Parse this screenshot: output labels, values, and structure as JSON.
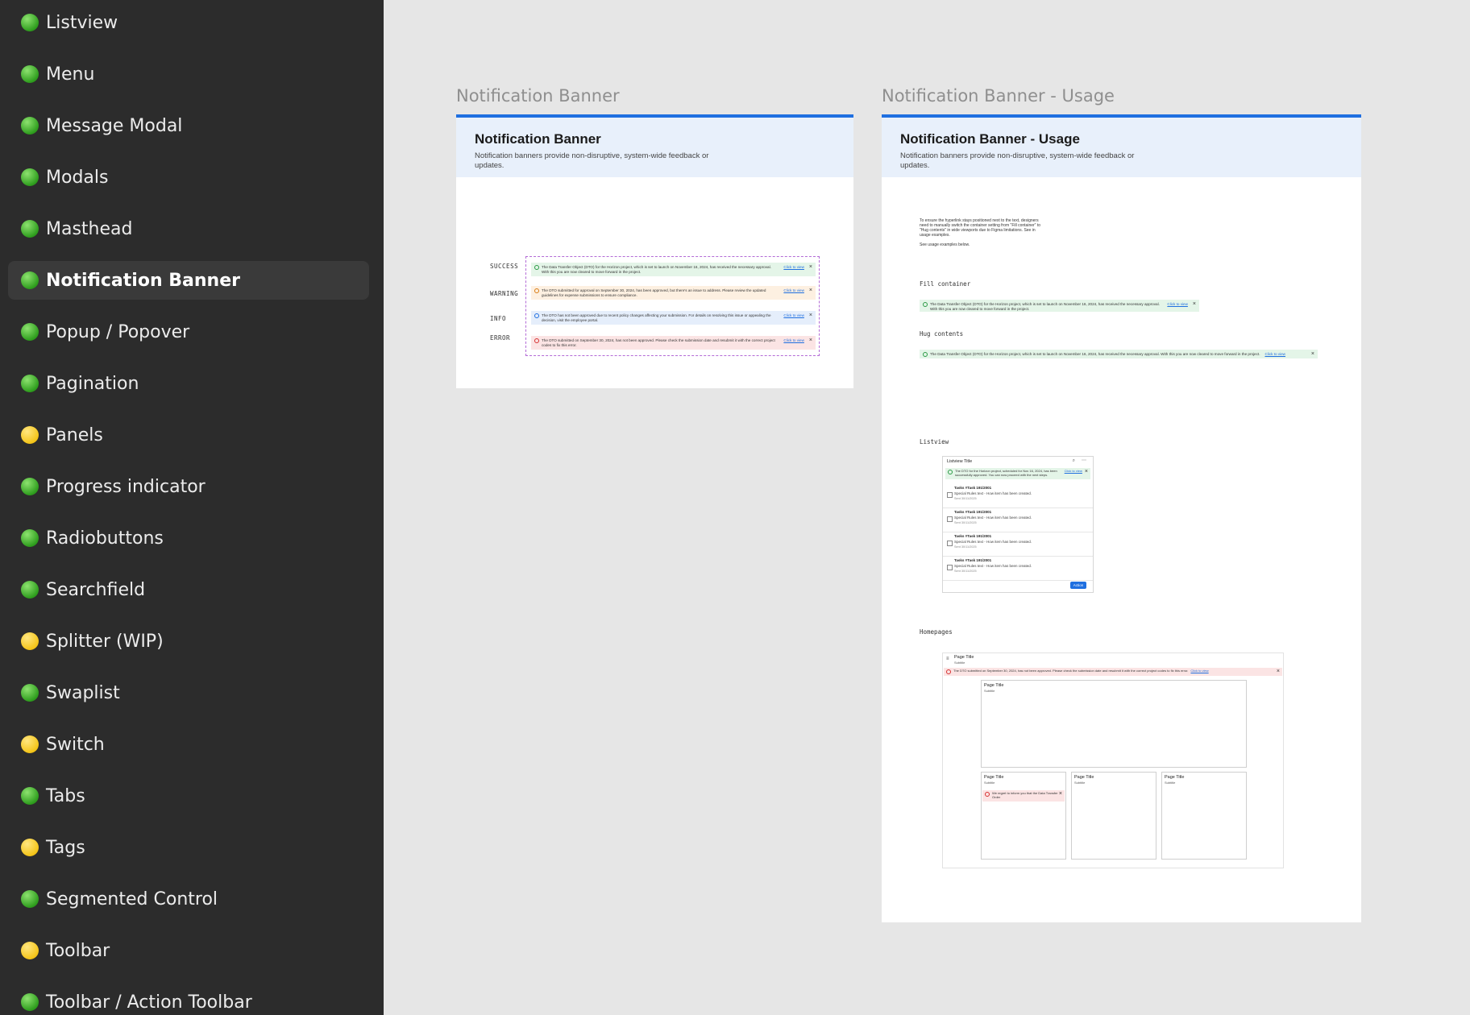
{
  "sidebar": {
    "items": [
      {
        "label": "Listview",
        "status": "green"
      },
      {
        "label": "Menu",
        "status": "green"
      },
      {
        "label": "Message Modal",
        "status": "green"
      },
      {
        "label": "Modals",
        "status": "green"
      },
      {
        "label": "Masthead",
        "status": "green"
      },
      {
        "label": "Notification Banner",
        "status": "green",
        "selected": true
      },
      {
        "label": "Popup / Popover",
        "status": "green"
      },
      {
        "label": "Pagination",
        "status": "green"
      },
      {
        "label": "Panels",
        "status": "yellow"
      },
      {
        "label": "Progress indicator",
        "status": "green"
      },
      {
        "label": "Radiobuttons",
        "status": "green"
      },
      {
        "label": "Searchfield",
        "status": "green"
      },
      {
        "label": "Splitter (WIP)",
        "status": "yellow"
      },
      {
        "label": "Swaplist",
        "status": "green"
      },
      {
        "label": "Switch",
        "status": "yellow"
      },
      {
        "label": "Tabs",
        "status": "green"
      },
      {
        "label": "Tags",
        "status": "yellow"
      },
      {
        "label": "Segmented Control",
        "status": "green"
      },
      {
        "label": "Toolbar",
        "status": "yellow"
      },
      {
        "label": "Toolbar / Action Toolbar",
        "status": "green"
      }
    ]
  },
  "colors": {
    "accent": "#1f6fe0",
    "success": "#2a9b45",
    "warning": "#d97b11",
    "error": "#d63030"
  },
  "frame1": {
    "label": "Notification Banner",
    "title": "Notification Banner",
    "description": "Notification banners provide non-disruptive, system-wide feedback or updates.",
    "link_text": "Click to view",
    "variants": [
      {
        "label": "SUCCESS",
        "type": "success",
        "text": "The Data Transfer Object (DTO) for the Horizon project, which is set to launch on November 16, 2024, has received the necessary approval. With this you are now cleared to move forward in the project."
      },
      {
        "label": "WARNING",
        "type": "warning",
        "text": "The DTO submitted for approval on September 30, 2024, has been approved, but there's an issue to address. Please review the updated guidelines for expense submissions to ensure compliance."
      },
      {
        "label": "INFO",
        "type": "info",
        "text": "The DTO has not been approved due to recent policy changes affecting your submission. For details on resolving this issue or appealing the decision, visit the employee portal."
      },
      {
        "label": "ERROR",
        "type": "error",
        "text": "The DTO submitted on September 30, 2024, has not been approved. Please check the submission date and resubmit it with the correct project codes to fix this error."
      }
    ]
  },
  "frame2": {
    "label": "Notification Banner - Usage",
    "title": "Notification Banner - Usage",
    "description": "Notification banners provide non-disruptive, system-wide feedback or updates.",
    "intro": "To ensure the hyperlink stays positioned next to the text, designers need to manually switch the container setting from \"Fill container\" to \"Hug contents\" in wide viewports due to Figma limitations. See in usage examples.",
    "intro2": "See usage examples below.",
    "fill_label": "Fill container",
    "fill_text": "The Data Transfer Object (DTO) for the Horizon project, which is set to launch on November 16, 2024, has received the necessary approval. With this you are now cleared to move forward in the project.",
    "hug_label": "Hug contents",
    "hug_text": "The Data Transfer Object (DTO) for the Horizon project, which is set to launch on November 16, 2024, has received the necessary approval. With this you are now cleared to move forward in the project.",
    "link_text": "Click to view",
    "listview_label": "Listview",
    "listview": {
      "title": "Listview Title",
      "banner": "The DTO for the Horizon project, scheduled for Nov 16, 2024, has been successfully approved. You can now proceed with the next steps.",
      "rows": [
        {
          "title": "Tasks #Task 191/2001",
          "line": "Special Rules text - How item has been created.",
          "date": "Sent 30/11/2025"
        },
        {
          "title": "Tasks #Task 191/2001",
          "line": "Special Rules text - How item has been created.",
          "date": "Sent 30/11/2025"
        },
        {
          "title": "Tasks #Task 191/2001",
          "line": "Special Rules text - How item has been created.",
          "date": "Sent 30/11/2025"
        },
        {
          "title": "Tasks #Task 191/2001",
          "line": "Special Rules text - How item has been created.",
          "date": "Sent 30/11/2025"
        }
      ],
      "action": "Action"
    },
    "homepages_label": "Homepages",
    "homepage": {
      "title": "Page Title",
      "subtitle": "Subtitle",
      "banner": "The DTO submitted on September 30, 2024, has not been approved. Please check the submission date and resubmit it with the correct project codes to fix this error.",
      "card_title": "Page Title",
      "card_subtitle": "Subtitle",
      "card_banner": "We regret to inform you that the Data Transfer Order"
    }
  }
}
